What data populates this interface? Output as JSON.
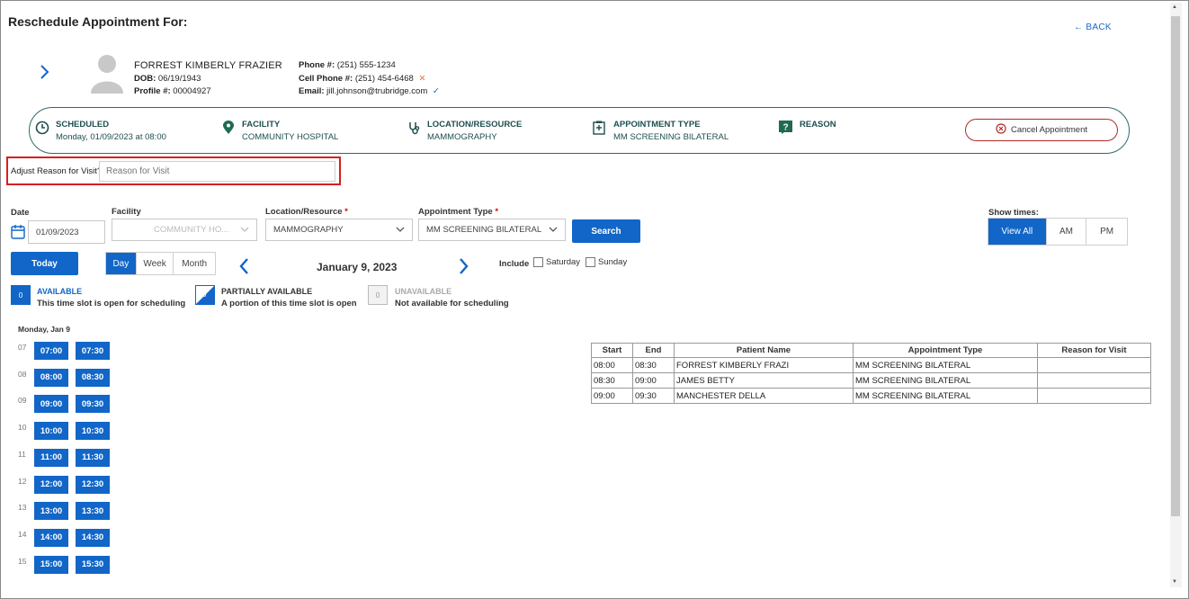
{
  "header": {
    "title": "Reschedule Appointment For:",
    "back_label": "← BACK"
  },
  "patient": {
    "name": "FORREST  KIMBERLY FRAZIER",
    "dob_label": "DOB:",
    "dob": "06/19/1943",
    "profile_label": "Profile #:",
    "profile": "00004927",
    "phone_label": "Phone #:",
    "phone": "(251) 555-1234",
    "cell_label": "Cell Phone #:",
    "cell": "(251) 454-6468",
    "email_label": "Email:",
    "email": "jill.johnson@trubridge.com"
  },
  "summary": {
    "scheduled_label": "SCHEDULED",
    "scheduled_value": "Monday, 01/09/2023 at 08:00",
    "facility_label": "FACILITY",
    "facility_value": "COMMUNITY HOSPITAL",
    "location_label": "LOCATION/RESOURCE",
    "location_value": "MAMMOGRAPHY",
    "appt_type_label": "APPOINTMENT TYPE",
    "appt_type_value": "MM SCREENING BILATERAL",
    "reason_label": "REASON",
    "cancel_label": "Cancel Appointment"
  },
  "reason": {
    "label": "Adjust Reason for Visit?",
    "placeholder": "Reason for Visit"
  },
  "filters": {
    "date_label": "Date",
    "date_value": "01/09/2023",
    "facility_label": "Facility",
    "facility_value": "COMMUNITY HO...",
    "location_label": "Location/Resource",
    "location_value": "MAMMOGRAPHY",
    "appt_type_label": "Appointment Type",
    "appt_type_value": "MM SCREENING BILATERAL",
    "required_mark": "*",
    "search_label": "Search",
    "show_times_label": "Show times:",
    "show_times": [
      "View All",
      "AM",
      "PM"
    ]
  },
  "nav": {
    "today_label": "Today",
    "views": [
      "Day",
      "Week",
      "Month"
    ],
    "current_date": "January 9, 2023",
    "include_label": "Include",
    "saturday_label": "Saturday",
    "sunday_label": "Sunday"
  },
  "legend": {
    "available_count": "0",
    "available_title": "AVAILABLE",
    "available_desc": "This time slot is open for scheduling",
    "partial_count": "0",
    "partial_title": "PARTIALLY AVAILABLE",
    "partial_desc": "A portion of this time slot is open",
    "unavailable_count": "0",
    "unavailable_title": "UNAVAILABLE",
    "unavailable_desc": "Not available for scheduling"
  },
  "schedule": {
    "day_label": "Monday, Jan 9",
    "rows": [
      {
        "hour": "07",
        "slots": [
          "07:00",
          "07:30"
        ]
      },
      {
        "hour": "08",
        "slots": [
          "08:00",
          "08:30"
        ]
      },
      {
        "hour": "09",
        "slots": [
          "09:00",
          "09:30"
        ]
      },
      {
        "hour": "10",
        "slots": [
          "10:00",
          "10:30"
        ]
      },
      {
        "hour": "11",
        "slots": [
          "11:00",
          "11:30"
        ]
      },
      {
        "hour": "12",
        "slots": [
          "12:00",
          "12:30"
        ]
      },
      {
        "hour": "13",
        "slots": [
          "13:00",
          "13:30"
        ]
      },
      {
        "hour": "14",
        "slots": [
          "14:00",
          "14:30"
        ]
      },
      {
        "hour": "15",
        "slots": [
          "15:00",
          "15:30"
        ]
      }
    ]
  },
  "appointments": {
    "headers": [
      "Start",
      "End",
      "Patient Name",
      "Appointment Type",
      "Reason for Visit"
    ],
    "rows": [
      [
        "08:00",
        "08:30",
        "FORREST KIMBERLY FRAZI",
        "MM SCREENING BILATERAL",
        ""
      ],
      [
        "08:30",
        "09:00",
        "JAMES BETTY",
        "MM SCREENING BILATERAL",
        ""
      ],
      [
        "09:00",
        "09:30",
        "MANCHESTER DELLA",
        "MM SCREENING BILATERAL",
        ""
      ]
    ]
  },
  "colors": {
    "primary": "#1166c8",
    "teal": "#2d6b6b",
    "danger": "#d61f1f"
  }
}
